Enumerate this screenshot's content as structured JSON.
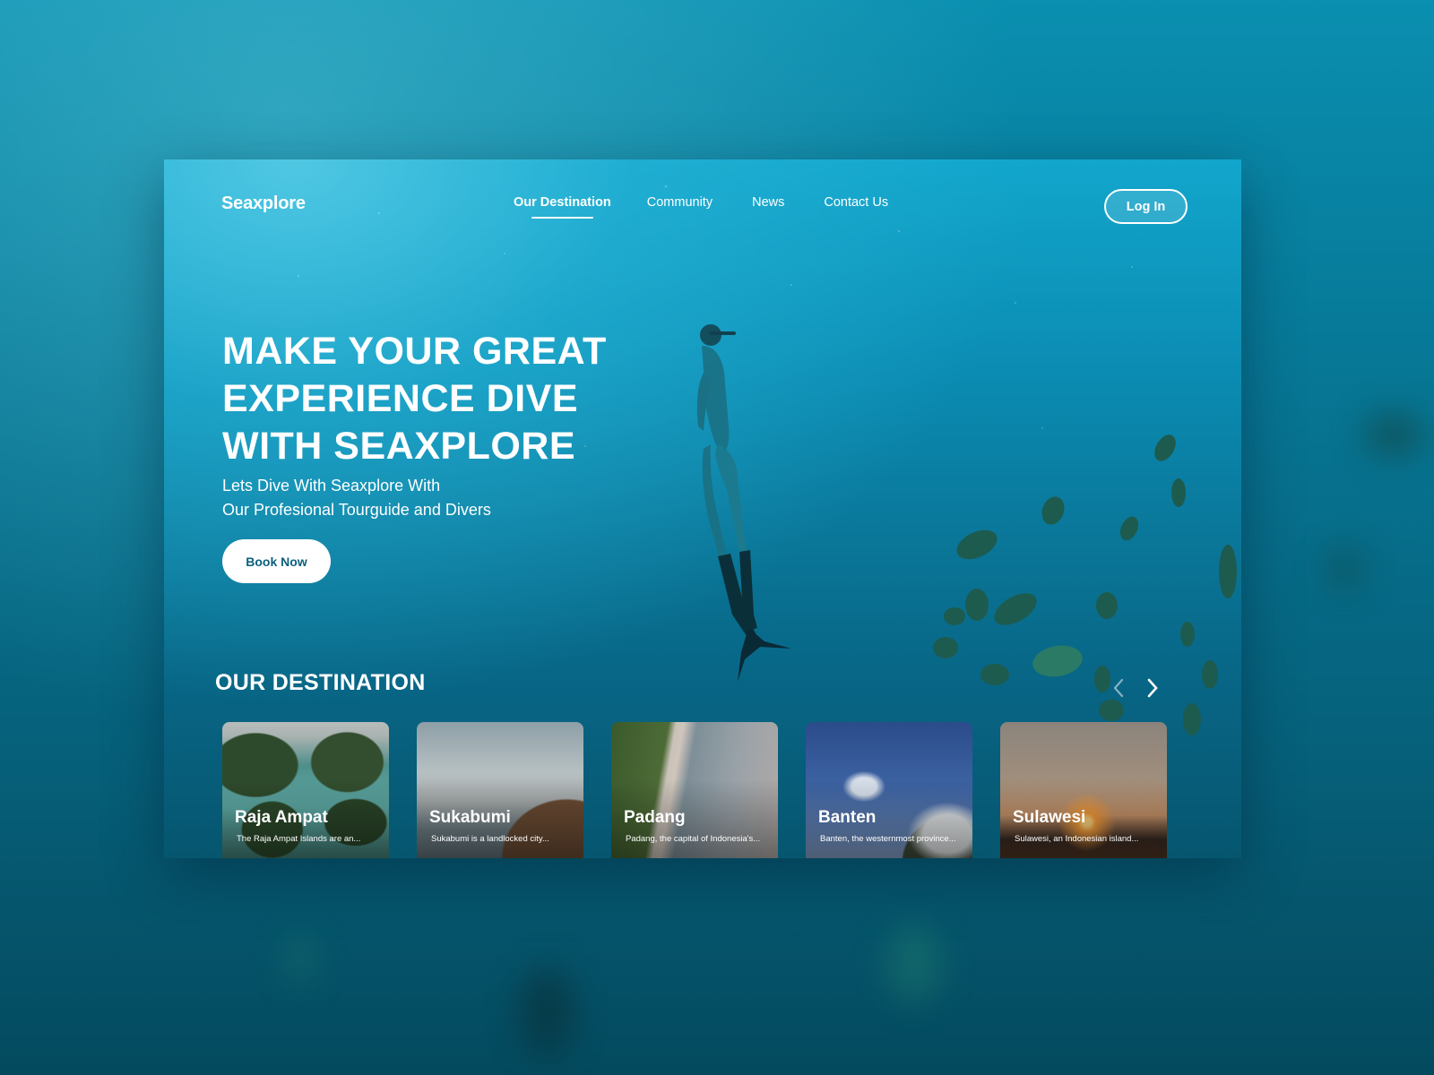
{
  "brand": {
    "name": "Seaxplore"
  },
  "nav": {
    "items": [
      {
        "label": "Our Destination",
        "active": true
      },
      {
        "label": "Community",
        "active": false
      },
      {
        "label": "News",
        "active": false
      },
      {
        "label": "Contact Us",
        "active": false
      }
    ],
    "login_label": "Log In"
  },
  "hero": {
    "title_lines": [
      "MAKE YOUR GREAT",
      "EXPERIENCE DIVE",
      "WITH SEAXPLORE"
    ],
    "subtitle_lines": [
      "Lets Dive With Seaxplore With",
      "Our Profesional Tourguide and Divers"
    ],
    "cta_label": "Book Now"
  },
  "destinations": {
    "title": "OUR DESTINATION",
    "prev_icon": "chevron-left-icon",
    "next_icon": "chevron-right-icon",
    "cards": [
      {
        "name": "Raja Ampat",
        "description": "The Raja Ampat Islands are an...",
        "scene": "islands"
      },
      {
        "name": "Sukabumi",
        "description": "Sukabumi is a landlocked city...",
        "scene": "coast"
      },
      {
        "name": "Padang",
        "description": "Padang, the capital of Indonesia's...",
        "scene": "beach"
      },
      {
        "name": "Banten",
        "description": "Banten, the westernmost province...",
        "scene": "sky"
      },
      {
        "name": "Sulawesi",
        "description": "Sulawesi, an Indonesian island...",
        "scene": "sunset"
      }
    ]
  },
  "colors": {
    "accent": "#ffffff",
    "cta_text": "#0b5f7d",
    "ocean_light": "#12a6cc",
    "ocean_dark": "#06566f"
  }
}
